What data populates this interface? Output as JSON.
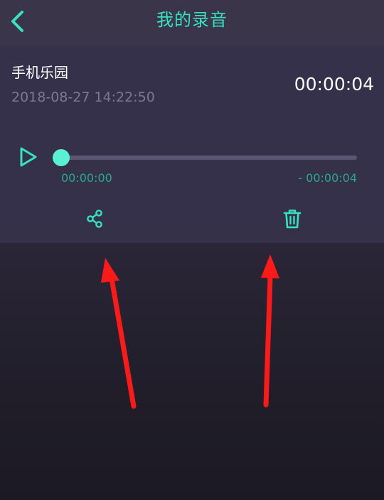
{
  "header": {
    "title": "我的录音",
    "back_icon": "chevron-left-icon",
    "accent_color": "#37e2c1"
  },
  "recording": {
    "name": "手机乐园",
    "date": "2018-08-27 14:22:50",
    "duration": "00:00:04"
  },
  "player": {
    "play_icon": "play-icon",
    "elapsed": "00:00:00",
    "remaining": "- 00:00:04",
    "progress_fraction": 0.0
  },
  "actions": {
    "share_icon": "share-icon",
    "delete_icon": "trash-icon"
  },
  "annotation": {
    "arrow_color": "#ff1a1a"
  }
}
